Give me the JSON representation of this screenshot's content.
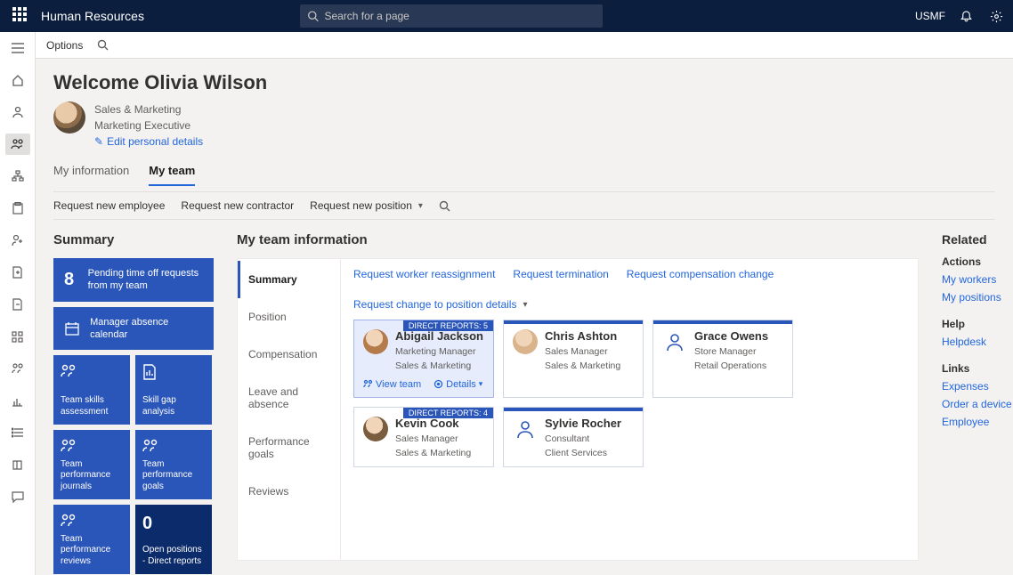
{
  "header": {
    "app_title": "Human Resources",
    "search_placeholder": "Search for a page",
    "company": "USMF"
  },
  "cmdbar": {
    "options": "Options"
  },
  "welcome": "Welcome Olivia Wilson",
  "persona": {
    "dept": "Sales & Marketing",
    "role": "Marketing Executive",
    "edit": "Edit personal details"
  },
  "tabs": {
    "info": "My information",
    "team": "My team"
  },
  "actionbar": {
    "new_employee": "Request new employee",
    "new_contractor": "Request new contractor",
    "new_position": "Request new position"
  },
  "summary": {
    "title": "Summary",
    "pending_count": "8",
    "pending_label": "Pending time off requests from my team",
    "calendar": "Manager absence calendar",
    "tiles": {
      "skills": "Team skills assessment",
      "gap": "Skill gap analysis",
      "journals": "Team performance journals",
      "goals": "Team performance goals",
      "reviews": "Team performance reviews",
      "open_num": "0",
      "open_label": "Open positions - Direct reports"
    }
  },
  "team": {
    "title": "My team information",
    "subnav": {
      "summary": "Summary",
      "position": "Position",
      "compensation": "Compensation",
      "leave": "Leave and absence",
      "perf": "Performance goals",
      "reviews": "Reviews"
    },
    "links": {
      "reassign": "Request worker reassignment",
      "terminate": "Request termination",
      "comp": "Request compensation change",
      "posdetails": "Request change to position details"
    },
    "card_actions": {
      "view": "View team",
      "details": "Details"
    },
    "cards": [
      {
        "name": "Abigail Jackson",
        "role": "Marketing Manager",
        "dept": "Sales & Marketing",
        "badge": "DIRECT REPORTS: 5",
        "avatar": true,
        "selected": true
      },
      {
        "name": "Chris Ashton",
        "role": "Sales Manager",
        "dept": "Sales & Marketing",
        "bar": true,
        "avatar": true
      },
      {
        "name": "Grace Owens",
        "role": "Store Manager",
        "dept": "Retail Operations",
        "bar": true,
        "avatar": false
      },
      {
        "name": "Kevin Cook",
        "role": "Sales Manager",
        "dept": "Sales & Marketing",
        "badge": "DIRECT REPORTS: 4",
        "avatar": true
      },
      {
        "name": "Sylvie Rocher",
        "role": "Consultant",
        "dept": "Client Services",
        "bar": true,
        "avatar": false
      }
    ]
  },
  "right": {
    "related": "Related",
    "actions": "Actions",
    "workers": "My workers",
    "positions": "My positions",
    "help": "Help",
    "helpdesk": "Helpdesk",
    "links": "Links",
    "expenses": "Expenses",
    "order": "Order a device",
    "employee": "Employee"
  }
}
